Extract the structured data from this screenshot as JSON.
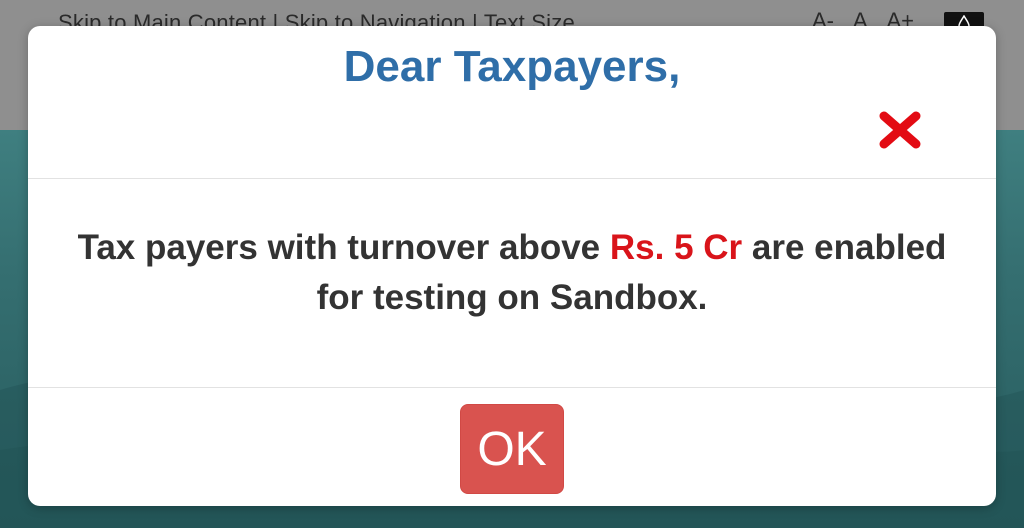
{
  "background": {
    "top_links": "Skip to Main Content  |  Skip to Navigation  |  Text Size",
    "font_sizes": [
      "A-",
      "A",
      "A+"
    ],
    "contrast_icon": "contrast-icon"
  },
  "modal": {
    "title": "Dear Taxpayers,",
    "close_icon": "close-x-icon",
    "message_part1": "Tax payers with turnover above ",
    "message_highlight": "Rs. 5 Cr",
    "message_part2": " are enabled for testing on Sandbox.",
    "ok_label": "OK"
  },
  "colors": {
    "title": "#2f6ea8",
    "highlight": "#d9141a",
    "ok_button": "#d9534f",
    "close_icon": "#e30b13"
  }
}
